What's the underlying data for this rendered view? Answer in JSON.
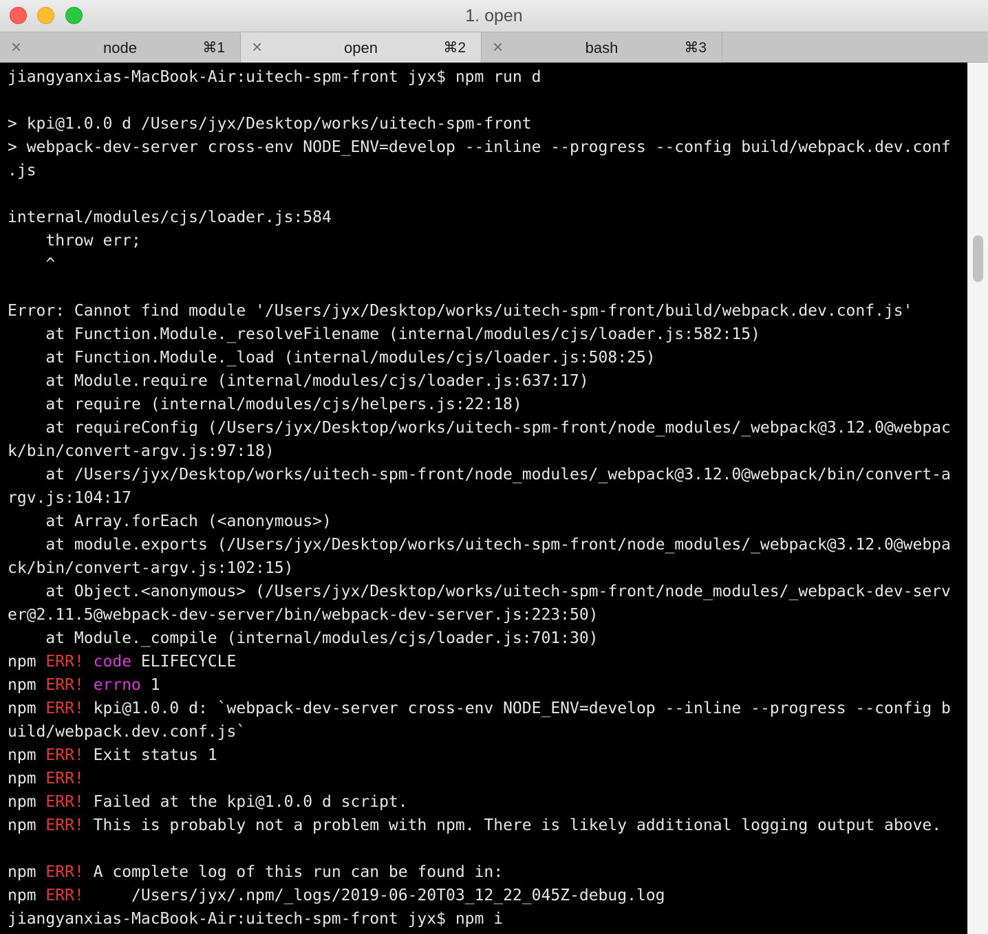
{
  "window": {
    "title": "1. open"
  },
  "tabs": [
    {
      "name": "node",
      "shortcut": "⌘1",
      "active": false
    },
    {
      "name": "open",
      "shortcut": "⌘2",
      "active": true
    },
    {
      "name": "bash",
      "shortcut": "⌘3",
      "active": false
    }
  ],
  "icons": {
    "close": "close-icon"
  },
  "colors": {
    "error": "#e53935",
    "keyword": "#d63bd6",
    "text": "#e6e6e6",
    "background": "#000000"
  },
  "terminal": {
    "lines": [
      {
        "t": "jiangyanxias-MacBook-Air:uitech-spm-front jyx$ npm run d"
      },
      {
        "t": ""
      },
      {
        "t": "> kpi@1.0.0 d /Users/jyx/Desktop/works/uitech-spm-front"
      },
      {
        "t": "> webpack-dev-server cross-env NODE_ENV=develop --inline --progress --config build/webpack.dev.conf"
      },
      {
        "t": ".js"
      },
      {
        "t": ""
      },
      {
        "t": "internal/modules/cjs/loader.js:584"
      },
      {
        "t": "    throw err;"
      },
      {
        "t": "    ^"
      },
      {
        "t": ""
      },
      {
        "t": "Error: Cannot find module '/Users/jyx/Desktop/works/uitech-spm-front/build/webpack.dev.conf.js'"
      },
      {
        "t": "    at Function.Module._resolveFilename (internal/modules/cjs/loader.js:582:15)"
      },
      {
        "t": "    at Function.Module._load (internal/modules/cjs/loader.js:508:25)"
      },
      {
        "t": "    at Module.require (internal/modules/cjs/loader.js:637:17)"
      },
      {
        "t": "    at require (internal/modules/cjs/helpers.js:22:18)"
      },
      {
        "t": "    at requireConfig (/Users/jyx/Desktop/works/uitech-spm-front/node_modules/_webpack@3.12.0@webpac"
      },
      {
        "t": "k/bin/convert-argv.js:97:18)"
      },
      {
        "t": "    at /Users/jyx/Desktop/works/uitech-spm-front/node_modules/_webpack@3.12.0@webpack/bin/convert-a"
      },
      {
        "t": "rgv.js:104:17"
      },
      {
        "t": "    at Array.forEach (<anonymous>)"
      },
      {
        "t": "    at module.exports (/Users/jyx/Desktop/works/uitech-spm-front/node_modules/_webpack@3.12.0@webpa"
      },
      {
        "t": "ck/bin/convert-argv.js:102:15)"
      },
      {
        "t": "    at Object.<anonymous> (/Users/jyx/Desktop/works/uitech-spm-front/node_modules/_webpack-dev-serv"
      },
      {
        "t": "er@2.11.5@webpack-dev-server/bin/webpack-dev-server.js:223:50)"
      },
      {
        "t": "    at Module._compile (internal/modules/cjs/loader.js:701:30)"
      },
      {
        "p": "npm",
        "e": "ERR!",
        "k": "code",
        "t": "ELIFECYCLE"
      },
      {
        "p": "npm",
        "e": "ERR!",
        "k": "errno",
        "t": "1"
      },
      {
        "p": "npm",
        "e": "ERR!",
        "t": "kpi@1.0.0 d: `webpack-dev-server cross-env NODE_ENV=develop --inline --progress --config b"
      },
      {
        "t": "uild/webpack.dev.conf.js`"
      },
      {
        "p": "npm",
        "e": "ERR!",
        "t": "Exit status 1"
      },
      {
        "p": "npm",
        "e": "ERR!",
        "t": ""
      },
      {
        "p": "npm",
        "e": "ERR!",
        "t": "Failed at the kpi@1.0.0 d script."
      },
      {
        "p": "npm",
        "e": "ERR!",
        "t": "This is probably not a problem with npm. There is likely additional logging output above."
      },
      {
        "t": ""
      },
      {
        "p": "npm",
        "e": "ERR!",
        "t": "A complete log of this run can be found in:"
      },
      {
        "p": "npm",
        "e": "ERR!",
        "t": "    /Users/jyx/.npm/_logs/2019-06-20T03_12_22_045Z-debug.log"
      },
      {
        "t": "jiangyanxias-MacBook-Air:uitech-spm-front jyx$ npm i"
      }
    ]
  }
}
